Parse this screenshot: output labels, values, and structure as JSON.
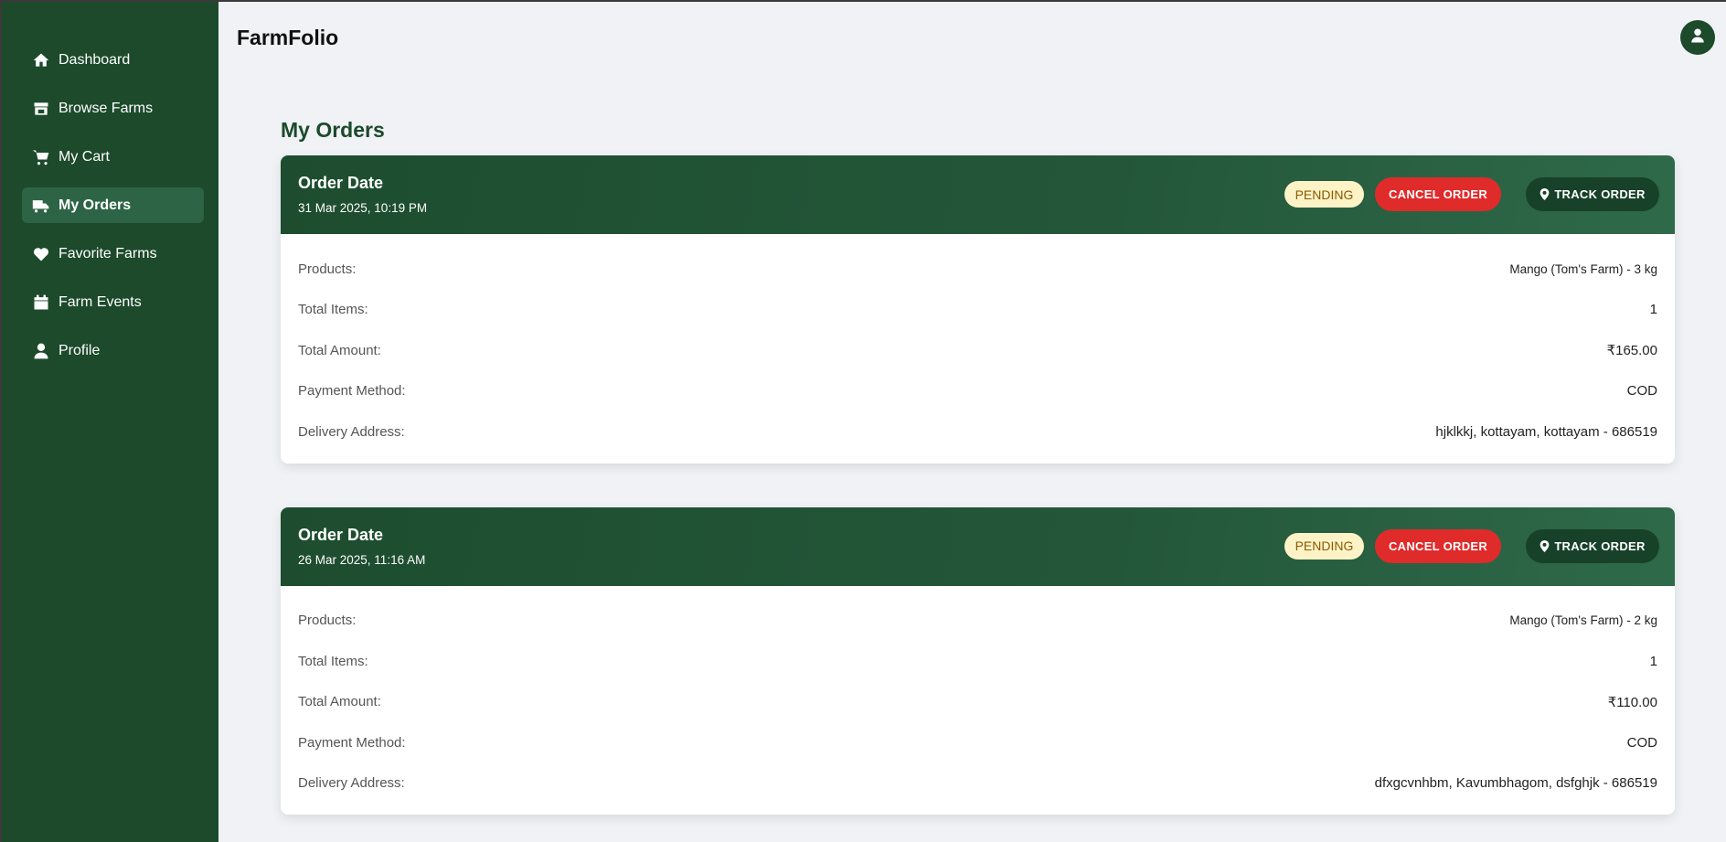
{
  "app": {
    "title": "FarmFolio"
  },
  "sidebar": {
    "items": [
      {
        "label": "Dashboard",
        "icon": "home-icon"
      },
      {
        "label": "Browse Farms",
        "icon": "store-icon"
      },
      {
        "label": "My Cart",
        "icon": "cart-icon"
      },
      {
        "label": "My Orders",
        "icon": "truck-icon",
        "active": true
      },
      {
        "label": "Favorite Farms",
        "icon": "heart-icon"
      },
      {
        "label": "Farm Events",
        "icon": "calendar-icon"
      },
      {
        "label": "Profile",
        "icon": "user-icon"
      }
    ]
  },
  "header": {
    "avatar_icon": "user-icon"
  },
  "main": {
    "title": "My Orders",
    "labels": {
      "order_date": "Order Date",
      "products": "Products:",
      "total_items": "Total Items:",
      "total_amount": "Total Amount:",
      "payment_method": "Payment Method:",
      "delivery_address": "Delivery Address:"
    },
    "orders": [
      {
        "date": "31 Mar 2025, 10:19 PM",
        "status": "PENDING",
        "cancel_label": "CANCEL ORDER",
        "track_label": "TRACK ORDER",
        "products": "Mango (Tom's Farm) - 3 kg",
        "total_items": "1",
        "total_amount": "₹165.00",
        "payment_method": "COD",
        "delivery_address": "hjklkkj, kottayam, kottayam - 686519"
      },
      {
        "date": "26 Mar 2025, 11:16 AM",
        "status": "PENDING",
        "cancel_label": "CANCEL ORDER",
        "track_label": "TRACK ORDER",
        "products": "Mango (Tom's Farm) - 2 kg",
        "total_items": "1",
        "total_amount": "₹110.00",
        "payment_method": "COD",
        "delivery_address": "dfxgcvnhbm, Kavumbhagom, dsfghjk - 686519"
      }
    ]
  },
  "colors": {
    "sidebar_bg": "#1c4a2b",
    "sidebar_active": "#2d6446",
    "accent_green": "#1c4a2b",
    "cancel_red": "#e02b2b",
    "pending_bg": "#fdf3c7",
    "pending_text": "#8a5a00",
    "page_bg": "#f0f2f5"
  }
}
